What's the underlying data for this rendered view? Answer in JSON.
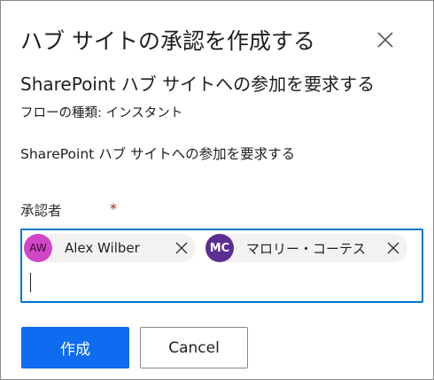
{
  "dialog": {
    "title": "ハブ サイトの承認を作成する",
    "subtitle": "SharePoint ハブ サイトへの参加を要求する",
    "flow_type": "フローの種類: インスタント",
    "description": "SharePoint ハブ サイトへの参加を要求する"
  },
  "approvers": {
    "label": "承認者",
    "required_marker": "*",
    "people": [
      {
        "initials": "AW",
        "name": "Alex Wilber",
        "avatar_color": "#d046c4"
      },
      {
        "initials": "MC",
        "name": "マロリー・コーテス",
        "avatar_color": "#5c2e91"
      }
    ]
  },
  "buttons": {
    "create": "作成",
    "cancel": "Cancel"
  },
  "colors": {
    "accent": "#0f6cf0",
    "focus_border": "#0078d4",
    "required": "#a4262c"
  },
  "icons": {
    "close": "close-icon",
    "remove": "remove-person-icon"
  }
}
